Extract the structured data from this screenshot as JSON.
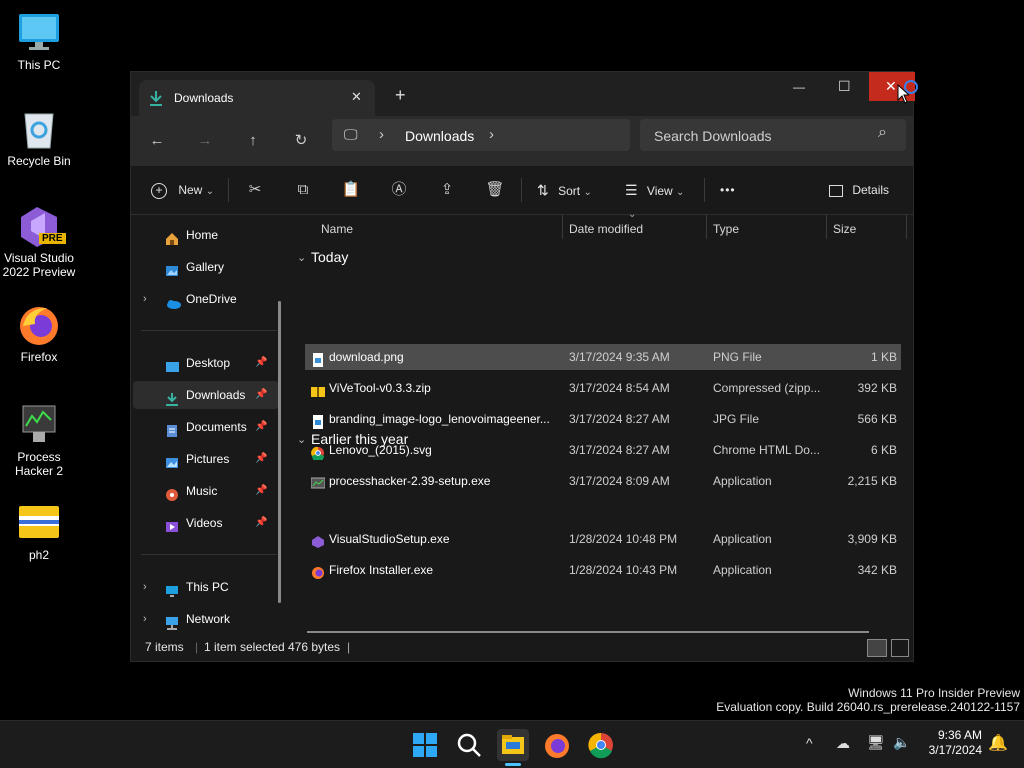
{
  "desktop": {
    "icons": [
      {
        "label": "This PC"
      },
      {
        "label": "Recycle Bin"
      },
      {
        "label_line1": "Visual Studio",
        "label_line2": "2022 Preview",
        "badge": "PRE"
      },
      {
        "label": "Firefox"
      },
      {
        "label_line1": "Process",
        "label_line2": "Hacker 2"
      },
      {
        "label": "ph2"
      }
    ]
  },
  "window": {
    "tab_title": "Downloads",
    "tab_close": "✕",
    "new_tab": "+",
    "controls": {
      "minimize": "—",
      "maximize": "☐",
      "close": "✕"
    },
    "address": {
      "device_glyph": "🖵",
      "sep": "›",
      "location": "Downloads",
      "sep2": "›"
    },
    "search_placeholder": "Search Downloads",
    "nav_glyphs": {
      "back": "←",
      "forward": "→",
      "up": "↑",
      "refresh": "↻",
      "search": "⌕"
    },
    "commands": {
      "new": "New",
      "sort": "Sort",
      "view": "View",
      "more": "•••",
      "details": "Details",
      "dropdown": "⌄"
    },
    "sidebar": {
      "home": "Home",
      "gallery": "Gallery",
      "onedrive": "OneDrive",
      "desktop": "Desktop",
      "downloads": "Downloads",
      "documents": "Documents",
      "pictures": "Pictures",
      "music": "Music",
      "videos": "Videos",
      "thispc": "This PC",
      "network": "Network",
      "pin": "📌",
      "chevron": "›"
    },
    "columns": {
      "name": "Name",
      "date": "Date modified",
      "type": "Type",
      "size": "Size",
      "sort_caret": "⌄"
    },
    "groups": {
      "today": "Today",
      "earlier": "Earlier this year",
      "chevron": "⌄"
    },
    "files": [
      {
        "name": "download.png",
        "date": "3/17/2024 9:35 AM",
        "type": "PNG File",
        "size": "1 KB",
        "icon": "png-file-icon",
        "selected": true
      },
      {
        "name": "ViVeTool-v0.3.3.zip",
        "date": "3/17/2024 8:54 AM",
        "type": "Compressed (zipp...",
        "size": "392 KB",
        "icon": "zip-folder-icon"
      },
      {
        "name": "branding_image-logo_lenovoimageener...",
        "date": "3/17/2024 8:27 AM",
        "type": "JPG File",
        "size": "566 KB",
        "icon": "jpg-file-icon"
      },
      {
        "name": "Lenovo_(2015).svg",
        "date": "3/17/2024 8:27 AM",
        "type": "Chrome HTML Do...",
        "size": "6 KB",
        "icon": "chrome-icon"
      },
      {
        "name": "processhacker-2.39-setup.exe",
        "date": "3/17/2024 8:09 AM",
        "type": "Application",
        "size": "2,215 KB",
        "icon": "installer-icon"
      },
      {
        "name": "VisualStudioSetup.exe",
        "date": "1/28/2024 10:48 PM",
        "type": "Application",
        "size": "3,909 KB",
        "icon": "visual-studio-icon"
      },
      {
        "name": "Firefox Installer.exe",
        "date": "1/28/2024 10:43 PM",
        "type": "Application",
        "size": "342 KB",
        "icon": "firefox-icon"
      }
    ],
    "status": {
      "items": "7 items",
      "selected": "1 item selected",
      "bytes": "476 bytes",
      "bar": "|"
    }
  },
  "watermark": {
    "line1": "Windows 11 Pro Insider Preview",
    "line2": "Evaluation copy. Build 26040.rs_prerelease.240122-1157"
  },
  "taskbar": {
    "time": "9:36 AM",
    "date": "3/17/2024",
    "tray_chevron": "^"
  },
  "colors": {
    "accent": "#0078d4",
    "close_hover": "#c42b1c",
    "selection": "#4d4d4d"
  }
}
